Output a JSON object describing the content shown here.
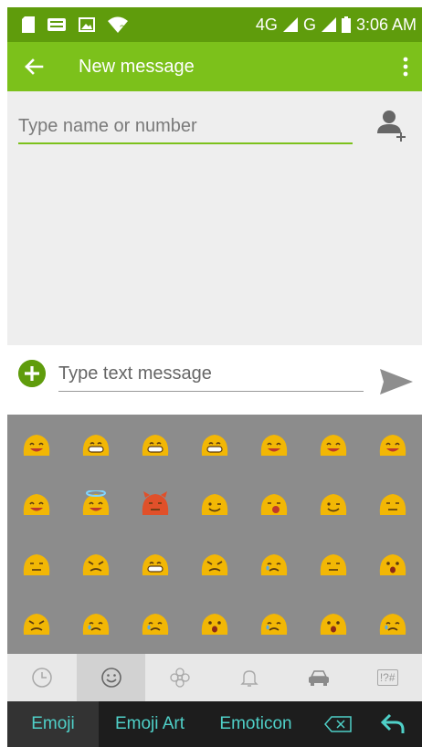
{
  "status_bar": {
    "network_4g": "4G",
    "network_g": "G",
    "time": "3:06 AM",
    "icons": [
      "sd-card-icon",
      "keyboard-icon",
      "image-icon",
      "wifi-icon",
      "signal-icon",
      "battery-icon"
    ]
  },
  "app_bar": {
    "title": "New message",
    "back_icon": "arrow-left-icon",
    "menu_icon": "more-vert-icon"
  },
  "recipient": {
    "placeholder": "Type name or number",
    "value": ""
  },
  "compose": {
    "placeholder": "Type text message",
    "value": ""
  },
  "keyboard": {
    "tabs": [
      {
        "name": "recent",
        "icon": "clock-icon"
      },
      {
        "name": "smileys",
        "icon": "smiley-icon",
        "selected": true
      },
      {
        "name": "nature",
        "icon": "flower-icon"
      },
      {
        "name": "objects",
        "icon": "bell-icon"
      },
      {
        "name": "places",
        "icon": "car-icon"
      },
      {
        "name": "symbols",
        "label": "!?#"
      }
    ],
    "bottom_bar": {
      "emoji": "Emoji",
      "emoji_art": "Emoji Art",
      "emoticon": "Emoticon"
    },
    "emoji_grid": [
      [
        "smiling-face",
        "grinning-face",
        "grinning-face-2",
        "grimacing-face",
        "smiling-blob",
        "laughing-face",
        "laughing-face-2"
      ],
      [
        "laughing-squint",
        "halo-face",
        "devil-face",
        "winking-face",
        "tongue-out-face",
        "smirking-face",
        "unamused-face"
      ],
      [
        "confused-face",
        "angry-face",
        "grimacing-face-2",
        "persevering-face",
        "crying-face",
        "sleeping-face",
        "surprised-face"
      ],
      [
        "frowning-face",
        "tearful-face",
        "sad-face",
        "anguished-face",
        "disappointed-face",
        "screaming-face",
        "sobbing-face"
      ]
    ],
    "colors": {
      "emoji": "#f2b705",
      "accent": "#4fd0c8"
    }
  },
  "colors": {
    "status_bar": "#5f9c0c",
    "app_bar": "#7cc11b"
  }
}
